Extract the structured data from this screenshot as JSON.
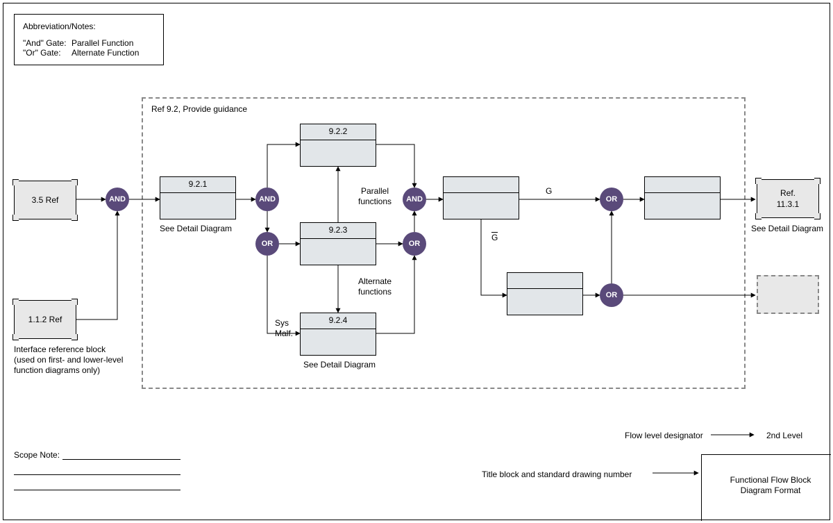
{
  "legend": {
    "title": "Abbreviation/Notes:",
    "and_label": "\"And\" Gate:",
    "and_desc": "Parallel Function",
    "or_label": "\"Or\" Gate:",
    "or_desc": "Alternate Function"
  },
  "container": {
    "title": "Ref 9.2, Provide guidance"
  },
  "ref35": {
    "label": "3.5 Ref"
  },
  "ref112": {
    "label": "1.1.2 Ref"
  },
  "ref1131": {
    "line1": "Ref.",
    "line2": "11.3.1"
  },
  "iface_caption": "Interface reference block (used on first- and lower-level function diagrams only)",
  "b921": {
    "hdr": "9.2.1"
  },
  "b922": {
    "hdr": "9.2.2"
  },
  "b923": {
    "hdr": "9.2.3"
  },
  "b924": {
    "hdr": "9.2.4"
  },
  "gate": {
    "and": "AND",
    "or": "OR"
  },
  "caption": {
    "see_detail_1": "See Detail Diagram",
    "see_detail_2": "See Detail Diagram",
    "see_detail_3": "See Detail Diagram",
    "parallel": "Parallel\nfunctions",
    "alternate": "Alternate\nfunctions",
    "sys_malf": "Sys\nMalf.",
    "g": "G",
    "gbar": "G",
    "flow_level": "Flow level designator",
    "second_level": "2nd Level",
    "title_block": "Title block and standard drawing number",
    "ffbd": "Functional Flow Block\nDiagram Format",
    "scope": "Scope Note:"
  }
}
